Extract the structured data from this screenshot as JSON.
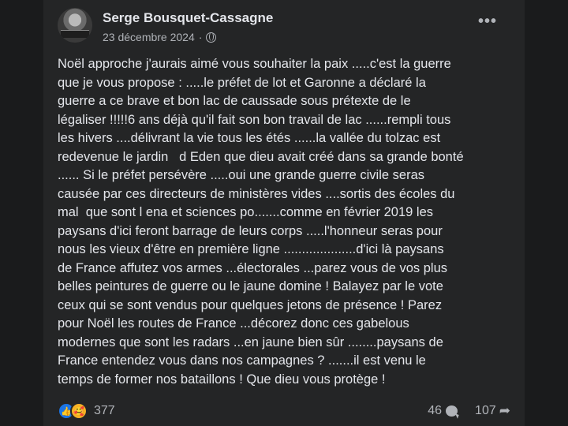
{
  "post": {
    "author": "Serge Bousquet-Cassagne",
    "date": "23 décembre 2024",
    "separator": "·",
    "more_label": "•••",
    "lines": [
      "Noël approche j'aurais aimé vous souhaiter la paix .....c'est la guerre",
      "que je vous propose : .....le préfet de lot et Garonne a déclaré la",
      "guerre a ce brave et bon lac de caussade sous prétexte de le",
      "légaliser !!!!!6 ans déjà qu'il fait son bon travail de lac ......rempli tous",
      "les hivers ....délivrant la vie tous les étés ......la vallée du tolzac est",
      "redevenue le jardin   d Eden que dieu avait créé dans sa grande bonté",
      "...... Si le préfet persévère .....oui une grande guerre civile seras",
      "causée par ces directeurs de ministères vides ....sortis des écoles du",
      "mal  que sont l ena et sciences po.......comme en février 2019 les",
      "paysans d'ici feront barrage de leurs corps .....l'honneur seras pour",
      "nous les vieux d'être en première ligne ....................d'ici là paysans",
      "de France affutez vos armes ...électorales ...parez vous de vos plus",
      "belles peintures de guerre ou le jaune domine ! Balayez par le vote",
      "ceux qui se sont vendus pour quelques jetons de présence ! Parez",
      "pour Noël les routes de France ...décorez donc ces gabelous",
      "modernes que sont les radars ...en jaune bien sûr ........paysans de",
      "France entendez vous dans nos campagnes ? .......il est venu le",
      "temps de former nos bataillons ! Que dieu vous protège !"
    ]
  },
  "stats": {
    "reactions": "377",
    "comments": "46",
    "shares": "107"
  },
  "icons": {
    "like": "thumbs-up",
    "care": "care-face",
    "comment": "comment-bubble",
    "share": "share-arrow",
    "privacy": "globe"
  }
}
